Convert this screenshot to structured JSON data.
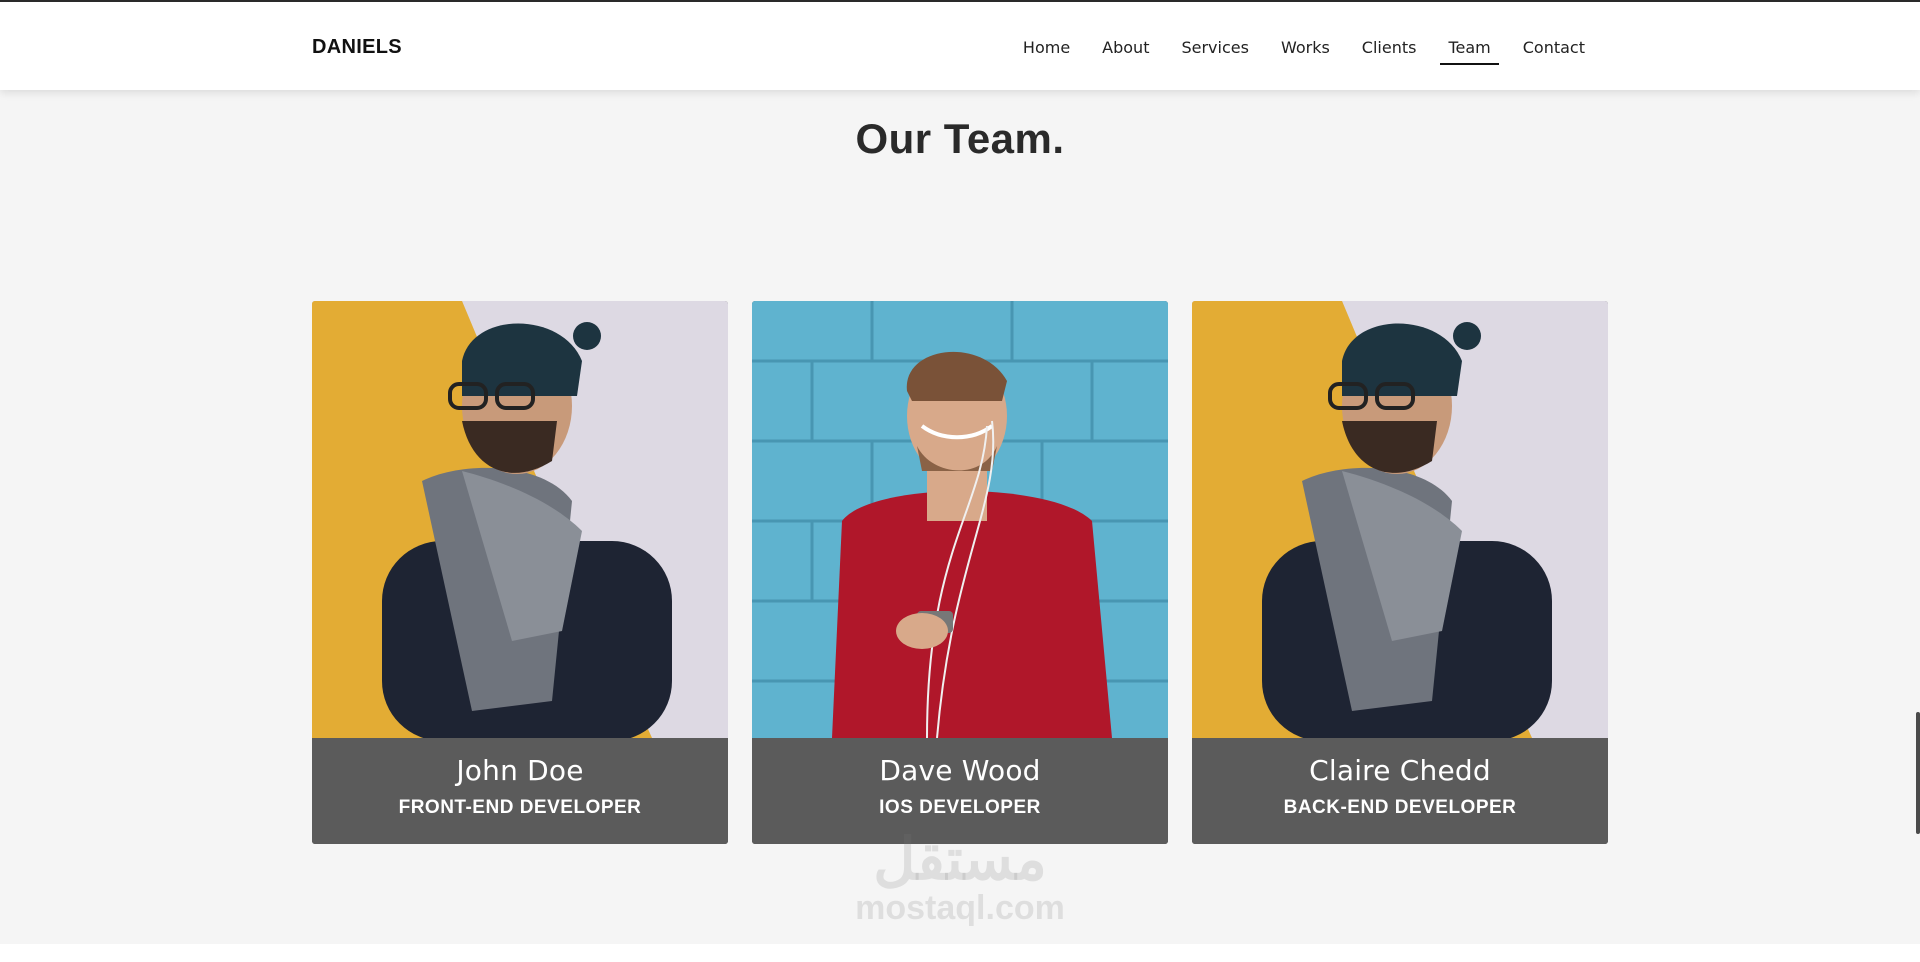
{
  "brand": "DANIELS",
  "nav": [
    {
      "label": "Home",
      "active": false
    },
    {
      "label": "About",
      "active": false
    },
    {
      "label": "Services",
      "active": false
    },
    {
      "label": "Works",
      "active": false
    },
    {
      "label": "Clients",
      "active": false
    },
    {
      "label": "Team",
      "active": true
    },
    {
      "label": "Contact",
      "active": false
    }
  ],
  "section_title": "Our Team.",
  "team": [
    {
      "name": "John Doe",
      "role": "FRONT-END DEVELOPER",
      "photo": "man-beanie-scarf-yellow-wall"
    },
    {
      "name": "Dave Wood",
      "role": "IOS DEVELOPER",
      "photo": "man-red-sweater-blue-wall"
    },
    {
      "name": "Claire Chedd",
      "role": "BACK-END DEVELOPER",
      "photo": "man-beanie-scarf-yellow-wall"
    }
  ],
  "watermark": {
    "arabic": "مستقل",
    "latin": "mostaql.com"
  },
  "colors": {
    "caption_bg": "#5b5b5b",
    "page_bg": "#f5f5f5",
    "accent_yellow": "#e8b33a",
    "accent_blue": "#5fb3cf",
    "sweater_red": "#b0172a"
  }
}
